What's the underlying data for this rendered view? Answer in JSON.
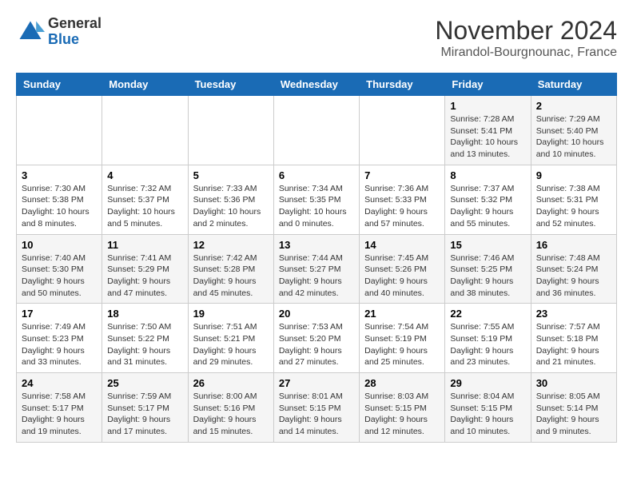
{
  "header": {
    "logo_general": "General",
    "logo_blue": "Blue",
    "month_title": "November 2024",
    "location": "Mirandol-Bourgnounac, France"
  },
  "weekdays": [
    "Sunday",
    "Monday",
    "Tuesday",
    "Wednesday",
    "Thursday",
    "Friday",
    "Saturday"
  ],
  "weeks": [
    [
      {
        "day": "",
        "info": ""
      },
      {
        "day": "",
        "info": ""
      },
      {
        "day": "",
        "info": ""
      },
      {
        "day": "",
        "info": ""
      },
      {
        "day": "",
        "info": ""
      },
      {
        "day": "1",
        "info": "Sunrise: 7:28 AM\nSunset: 5:41 PM\nDaylight: 10 hours\nand 13 minutes."
      },
      {
        "day": "2",
        "info": "Sunrise: 7:29 AM\nSunset: 5:40 PM\nDaylight: 10 hours\nand 10 minutes."
      }
    ],
    [
      {
        "day": "3",
        "info": "Sunrise: 7:30 AM\nSunset: 5:38 PM\nDaylight: 10 hours\nand 8 minutes."
      },
      {
        "day": "4",
        "info": "Sunrise: 7:32 AM\nSunset: 5:37 PM\nDaylight: 10 hours\nand 5 minutes."
      },
      {
        "day": "5",
        "info": "Sunrise: 7:33 AM\nSunset: 5:36 PM\nDaylight: 10 hours\nand 2 minutes."
      },
      {
        "day": "6",
        "info": "Sunrise: 7:34 AM\nSunset: 5:35 PM\nDaylight: 10 hours\nand 0 minutes."
      },
      {
        "day": "7",
        "info": "Sunrise: 7:36 AM\nSunset: 5:33 PM\nDaylight: 9 hours\nand 57 minutes."
      },
      {
        "day": "8",
        "info": "Sunrise: 7:37 AM\nSunset: 5:32 PM\nDaylight: 9 hours\nand 55 minutes."
      },
      {
        "day": "9",
        "info": "Sunrise: 7:38 AM\nSunset: 5:31 PM\nDaylight: 9 hours\nand 52 minutes."
      }
    ],
    [
      {
        "day": "10",
        "info": "Sunrise: 7:40 AM\nSunset: 5:30 PM\nDaylight: 9 hours\nand 50 minutes."
      },
      {
        "day": "11",
        "info": "Sunrise: 7:41 AM\nSunset: 5:29 PM\nDaylight: 9 hours\nand 47 minutes."
      },
      {
        "day": "12",
        "info": "Sunrise: 7:42 AM\nSunset: 5:28 PM\nDaylight: 9 hours\nand 45 minutes."
      },
      {
        "day": "13",
        "info": "Sunrise: 7:44 AM\nSunset: 5:27 PM\nDaylight: 9 hours\nand 42 minutes."
      },
      {
        "day": "14",
        "info": "Sunrise: 7:45 AM\nSunset: 5:26 PM\nDaylight: 9 hours\nand 40 minutes."
      },
      {
        "day": "15",
        "info": "Sunrise: 7:46 AM\nSunset: 5:25 PM\nDaylight: 9 hours\nand 38 minutes."
      },
      {
        "day": "16",
        "info": "Sunrise: 7:48 AM\nSunset: 5:24 PM\nDaylight: 9 hours\nand 36 minutes."
      }
    ],
    [
      {
        "day": "17",
        "info": "Sunrise: 7:49 AM\nSunset: 5:23 PM\nDaylight: 9 hours\nand 33 minutes."
      },
      {
        "day": "18",
        "info": "Sunrise: 7:50 AM\nSunset: 5:22 PM\nDaylight: 9 hours\nand 31 minutes."
      },
      {
        "day": "19",
        "info": "Sunrise: 7:51 AM\nSunset: 5:21 PM\nDaylight: 9 hours\nand 29 minutes."
      },
      {
        "day": "20",
        "info": "Sunrise: 7:53 AM\nSunset: 5:20 PM\nDaylight: 9 hours\nand 27 minutes."
      },
      {
        "day": "21",
        "info": "Sunrise: 7:54 AM\nSunset: 5:19 PM\nDaylight: 9 hours\nand 25 minutes."
      },
      {
        "day": "22",
        "info": "Sunrise: 7:55 AM\nSunset: 5:19 PM\nDaylight: 9 hours\nand 23 minutes."
      },
      {
        "day": "23",
        "info": "Sunrise: 7:57 AM\nSunset: 5:18 PM\nDaylight: 9 hours\nand 21 minutes."
      }
    ],
    [
      {
        "day": "24",
        "info": "Sunrise: 7:58 AM\nSunset: 5:17 PM\nDaylight: 9 hours\nand 19 minutes."
      },
      {
        "day": "25",
        "info": "Sunrise: 7:59 AM\nSunset: 5:17 PM\nDaylight: 9 hours\nand 17 minutes."
      },
      {
        "day": "26",
        "info": "Sunrise: 8:00 AM\nSunset: 5:16 PM\nDaylight: 9 hours\nand 15 minutes."
      },
      {
        "day": "27",
        "info": "Sunrise: 8:01 AM\nSunset: 5:15 PM\nDaylight: 9 hours\nand 14 minutes."
      },
      {
        "day": "28",
        "info": "Sunrise: 8:03 AM\nSunset: 5:15 PM\nDaylight: 9 hours\nand 12 minutes."
      },
      {
        "day": "29",
        "info": "Sunrise: 8:04 AM\nSunset: 5:15 PM\nDaylight: 9 hours\nand 10 minutes."
      },
      {
        "day": "30",
        "info": "Sunrise: 8:05 AM\nSunset: 5:14 PM\nDaylight: 9 hours\nand 9 minutes."
      }
    ]
  ]
}
